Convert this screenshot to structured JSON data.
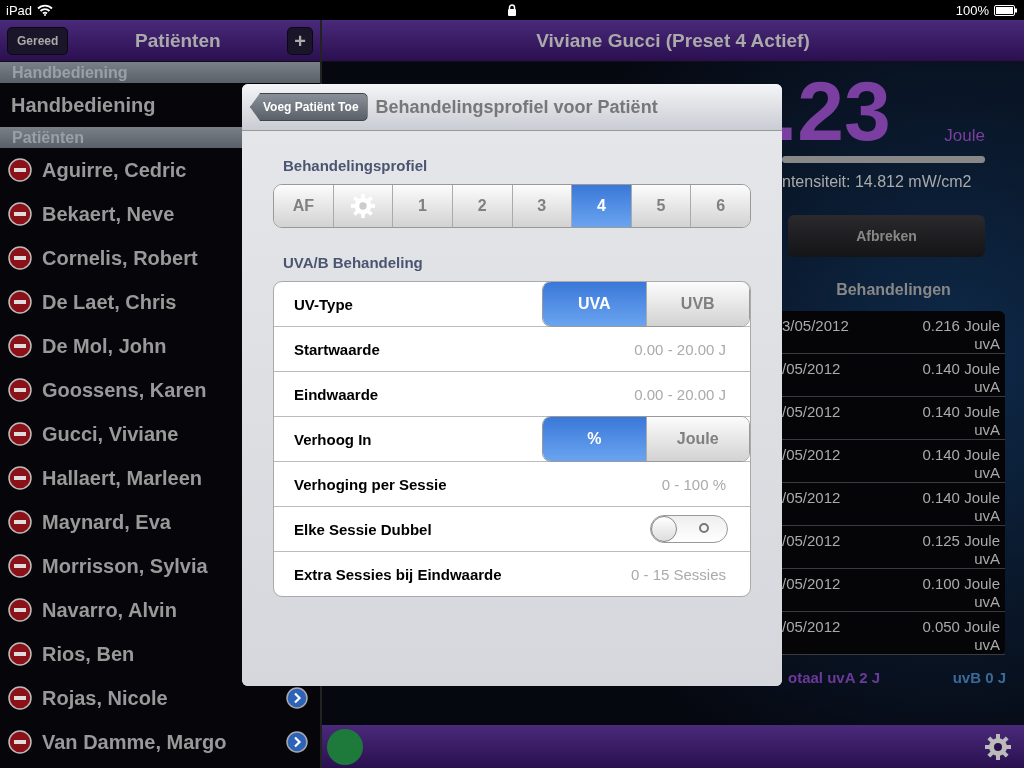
{
  "status_bar": {
    "device": "iPad",
    "battery": "100%"
  },
  "sidebar": {
    "done_button": "Gereed",
    "title": "Patiënten",
    "add_button": "+",
    "sections": [
      {
        "header": "Handbediening",
        "items": [
          {
            "kind": "plain",
            "name": "Handbediening",
            "disclosure": false
          }
        ]
      },
      {
        "header": "Patiënten",
        "items": [
          {
            "kind": "patient",
            "name": "Aguirre, Cedric",
            "disclosure": false
          },
          {
            "kind": "patient",
            "name": "Bekaert, Neve",
            "disclosure": false
          },
          {
            "kind": "patient",
            "name": "Cornelis, Robert",
            "disclosure": false
          },
          {
            "kind": "patient",
            "name": "De Laet, Chris",
            "disclosure": false
          },
          {
            "kind": "patient",
            "name": "De Mol, John",
            "disclosure": false
          },
          {
            "kind": "patient",
            "name": "Goossens, Karen",
            "disclosure": false
          },
          {
            "kind": "patient",
            "name": "Gucci, Viviane",
            "disclosure": false
          },
          {
            "kind": "patient",
            "name": "Hallaert, Marleen",
            "disclosure": false
          },
          {
            "kind": "patient",
            "name": "Maynard, Eva",
            "disclosure": false
          },
          {
            "kind": "patient",
            "name": "Morrisson, Sylvia",
            "disclosure": false
          },
          {
            "kind": "patient",
            "name": "Navarro, Alvin",
            "disclosure": false
          },
          {
            "kind": "patient",
            "name": "Rios, Ben",
            "disclosure": false
          },
          {
            "kind": "patient",
            "name": "Rojas, Nicole",
            "disclosure": true
          },
          {
            "kind": "patient",
            "name": "Van Damme, Margo",
            "disclosure": true
          }
        ]
      }
    ]
  },
  "main": {
    "title": "Viviane Gucci (Preset 4 Actief)",
    "dose": ".23",
    "unit": "Joule",
    "level": 1,
    "intensity": "ntensiteit: 14.812 mW/cm2",
    "abort_button": "Afbreken",
    "history_title": "Behandelingen",
    "history": [
      {
        "date": "3/05/2012",
        "amount": "0.216 Joule",
        "type": "uvA"
      },
      {
        "date": "/05/2012",
        "amount": "0.140 Joule",
        "type": "uvA"
      },
      {
        "date": "/05/2012",
        "amount": "0.140 Joule",
        "type": "uvA"
      },
      {
        "date": "/05/2012",
        "amount": "0.140 Joule",
        "type": "uvA"
      },
      {
        "date": "/05/2012",
        "amount": "0.140 Joule",
        "type": "uvA"
      },
      {
        "date": "/05/2012",
        "amount": "0.125 Joule",
        "type": "uvA"
      },
      {
        "date": "/05/2012",
        "amount": "0.100 Joule",
        "type": "uvA"
      },
      {
        "date": "/05/2012",
        "amount": "0.050 Joule",
        "type": "uvA"
      }
    ],
    "total_uva": "otaal uvA 2 J",
    "total_uvb": "uvB 0 J"
  },
  "popover": {
    "back_button": "Voeg Patiënt Toe",
    "title": "Behandelingsprofiel voor Patiënt",
    "profile_label": "Behandelingsprofiel",
    "profiles": [
      {
        "kind": "text",
        "label": "AF",
        "selected": false
      },
      {
        "kind": "gear",
        "selected": false
      },
      {
        "kind": "text",
        "label": "1",
        "selected": false
      },
      {
        "kind": "text",
        "label": "2",
        "selected": false
      },
      {
        "kind": "text",
        "label": "3",
        "selected": false
      },
      {
        "kind": "text",
        "label": "4",
        "selected": true
      },
      {
        "kind": "text",
        "label": "5",
        "selected": false
      },
      {
        "kind": "text",
        "label": "6",
        "selected": false
      }
    ],
    "uv_label": "UVA/B Behandeling",
    "rows": [
      {
        "kind": "segment",
        "label": "UV-Type",
        "options": [
          {
            "label": "UVA",
            "selected": true
          },
          {
            "label": "UVB",
            "selected": false
          }
        ]
      },
      {
        "kind": "range",
        "label": "Startwaarde",
        "placeholder": "0.00 - 20.00 J"
      },
      {
        "kind": "range",
        "label": "Eindwaarde",
        "placeholder": "0.00 - 20.00 J"
      },
      {
        "kind": "segment",
        "label": "Verhoog In",
        "options": [
          {
            "label": "%",
            "selected": true
          },
          {
            "label": "Joule",
            "selected": false
          }
        ]
      },
      {
        "kind": "range",
        "label": "Verhoging per Sessie",
        "placeholder": "0 - 100 %"
      },
      {
        "kind": "toggle",
        "label": "Elke Sessie Dubbel",
        "on": false
      },
      {
        "kind": "range",
        "label": "Extra Sessies bij Eindwaarde",
        "placeholder": "0 - 15 Sessies"
      }
    ]
  }
}
